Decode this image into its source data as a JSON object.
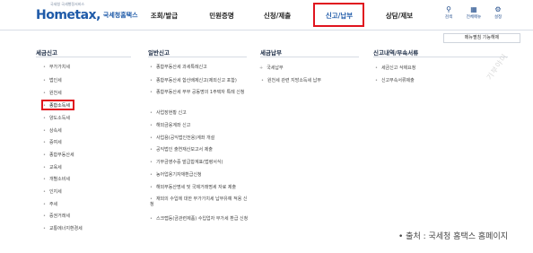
{
  "header": {
    "logo_top": "국세청 국세행정서비스",
    "logo_text": "Hometax,",
    "logo_sub": "국세청홈택스",
    "nav": [
      "조회/발급",
      "민원증명",
      "신청/제출",
      "신고/납부",
      "상담/제보"
    ],
    "active_nav": "신고/납부",
    "util": [
      {
        "icon": "search-icon",
        "label": "검색"
      },
      {
        "icon": "menu-grid-icon",
        "label": "전체메뉴"
      },
      {
        "icon": "gear-icon",
        "label": "설정"
      }
    ]
  },
  "menu_setting_label": "메뉴펼침 기능해제",
  "columns": {
    "col1": {
      "title": "세금신고",
      "items": [
        "부가가치세",
        "법인세",
        "원천세",
        "종합소득세",
        "양도소득세",
        "상속세",
        "증여세",
        "종합부동산세",
        "교육세",
        "개별소비세",
        "인지세",
        "주세",
        "증권거래세",
        "교통에너지환경세"
      ],
      "selected": "종합소득세"
    },
    "col2": {
      "title": "일반신고",
      "items": [
        "종합부동산세 과세특례신고",
        "종합부동산세 합산배제신고(제외신고 포함)",
        "종합부동산세 부부 공동명의 1주택자 특례 신청",
        "사업장현황 신고",
        "해외금융계좌 신고",
        "사업용(공익법인전용)계좌 개설",
        "공익법인 출연재산보고서 제출",
        "기부금영수증 발급합계표(법령서식)",
        "농어업용기자재환급신청",
        "해외부동산명세 및 국제거래명세 자료 제출",
        "재외의 수입에 대한 부가가치세 납부유예 적용 신청",
        "스크랩등(금관련제품) 수입업자 부가세 환급 신청"
      ]
    },
    "col3": {
      "title": "세금납부",
      "items": [
        "국세납부",
        "원천세 관련 지방소득세 납부"
      ]
    },
    "col4": {
      "title": "신고내역/부속서류",
      "items": [
        "세금신고 삭제요청",
        "신고부속서류제출"
      ]
    }
  },
  "watermark": "기부야미",
  "source_text": "• 출처 : 국세청 홈택스 홈페이지",
  "colors": {
    "brand": "#1e5aa8",
    "highlight": "#e0141e"
  }
}
